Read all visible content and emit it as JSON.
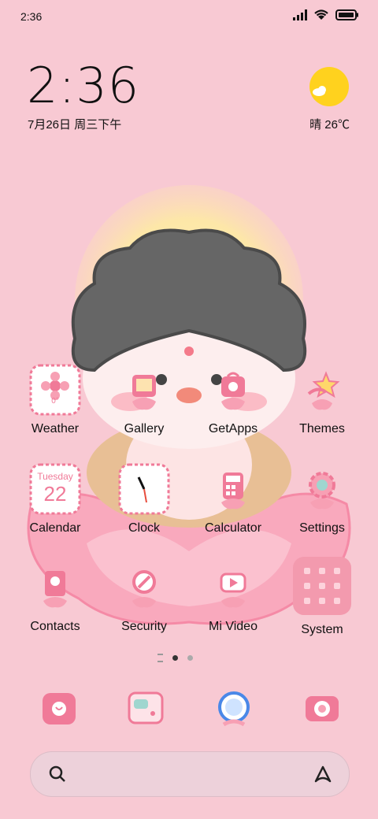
{
  "status": {
    "time": "2:36"
  },
  "clock": {
    "time": "2:36",
    "date": "7月26日 周三下午"
  },
  "weather": {
    "text": "晴 26℃"
  },
  "apps": {
    "row1": [
      {
        "label": "Weather",
        "icon": "weather-icon",
        "inner": "0°"
      },
      {
        "label": "Gallery",
        "icon": "gallery-icon"
      },
      {
        "label": "GetApps",
        "icon": "getapps-icon"
      },
      {
        "label": "Themes",
        "icon": "themes-icon"
      }
    ],
    "row2": [
      {
        "label": "Calendar",
        "icon": "calendar-icon",
        "inner_top": "Tuesday",
        "inner_num": "22"
      },
      {
        "label": "Clock",
        "icon": "clock-icon"
      },
      {
        "label": "Calculator",
        "icon": "calculator-icon"
      },
      {
        "label": "Settings",
        "icon": "settings-icon"
      }
    ],
    "row3": [
      {
        "label": "Contacts",
        "icon": "contacts-icon"
      },
      {
        "label": "Security",
        "icon": "security-icon"
      },
      {
        "label": "Mi Video",
        "icon": "mivideo-icon"
      },
      {
        "label": "System",
        "icon": "folder-icon"
      }
    ]
  },
  "dock": [
    "phone-icon",
    "messages-icon",
    "browser-icon",
    "camera-icon"
  ],
  "colors": {
    "background": "#f8c9d3",
    "accent": "#f07a98",
    "sun": "#ffd21e"
  }
}
